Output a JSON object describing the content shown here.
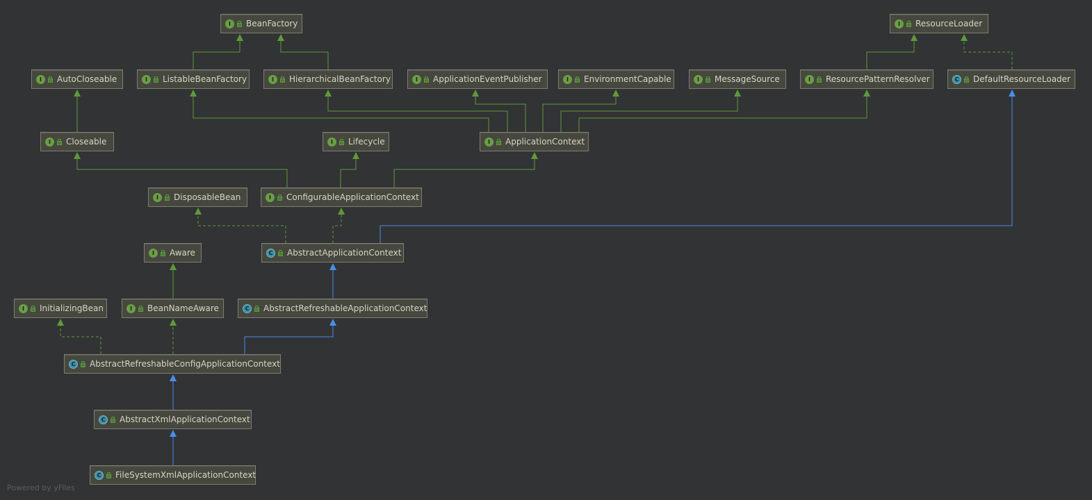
{
  "nodes": {
    "BeanFactory": {
      "label": "BeanFactory",
      "kind": "I"
    },
    "ResourceLoader": {
      "label": "ResourceLoader",
      "kind": "I"
    },
    "AutoCloseable": {
      "label": "AutoCloseable",
      "kind": "I"
    },
    "ListableBeanFactory": {
      "label": "ListableBeanFactory",
      "kind": "I"
    },
    "HierarchicalBeanFactory": {
      "label": "HierarchicalBeanFactory",
      "kind": "I"
    },
    "ApplicationEventPublisher": {
      "label": "ApplicationEventPublisher",
      "kind": "I"
    },
    "EnvironmentCapable": {
      "label": "EnvironmentCapable",
      "kind": "I"
    },
    "MessageSource": {
      "label": "MessageSource",
      "kind": "I"
    },
    "ResourcePatternResolver": {
      "label": "ResourcePatternResolver",
      "kind": "I"
    },
    "DefaultResourceLoader": {
      "label": "DefaultResourceLoader",
      "kind": "C"
    },
    "Closeable": {
      "label": "Closeable",
      "kind": "I"
    },
    "Lifecycle": {
      "label": "Lifecycle",
      "kind": "I"
    },
    "ApplicationContext": {
      "label": "ApplicationContext",
      "kind": "I"
    },
    "DisposableBean": {
      "label": "DisposableBean",
      "kind": "I"
    },
    "ConfigurableApplicationContext": {
      "label": "ConfigurableApplicationContext",
      "kind": "I"
    },
    "Aware": {
      "label": "Aware",
      "kind": "I"
    },
    "AbstractApplicationContext": {
      "label": "AbstractApplicationContext",
      "kind": "C"
    },
    "InitializingBean": {
      "label": "InitializingBean",
      "kind": "I"
    },
    "BeanNameAware": {
      "label": "BeanNameAware",
      "kind": "I"
    },
    "AbstractRefreshableApplicationContext": {
      "label": "AbstractRefreshableApplicationContext",
      "kind": "C"
    },
    "AbstractRefreshableConfigApplicationContext": {
      "label": "AbstractRefreshableConfigApplicationContext",
      "kind": "C"
    },
    "AbstractXmlApplicationContext": {
      "label": "AbstractXmlApplicationContext",
      "kind": "C"
    },
    "FileSystemXmlApplicationContext": {
      "label": "FileSystemXmlApplicationContext",
      "kind": "C"
    }
  },
  "relations": [
    {
      "from": "ListableBeanFactory",
      "to": "BeanFactory",
      "type": "extends"
    },
    {
      "from": "HierarchicalBeanFactory",
      "to": "BeanFactory",
      "type": "extends"
    },
    {
      "from": "ResourcePatternResolver",
      "to": "ResourceLoader",
      "type": "extends"
    },
    {
      "from": "DefaultResourceLoader",
      "to": "ResourceLoader",
      "type": "implements"
    },
    {
      "from": "Closeable",
      "to": "AutoCloseable",
      "type": "extends"
    },
    {
      "from": "ApplicationContext",
      "to": "ListableBeanFactory",
      "type": "extends"
    },
    {
      "from": "ApplicationContext",
      "to": "HierarchicalBeanFactory",
      "type": "extends"
    },
    {
      "from": "ApplicationContext",
      "to": "ApplicationEventPublisher",
      "type": "extends"
    },
    {
      "from": "ApplicationContext",
      "to": "EnvironmentCapable",
      "type": "extends"
    },
    {
      "from": "ApplicationContext",
      "to": "MessageSource",
      "type": "extends"
    },
    {
      "from": "ApplicationContext",
      "to": "ResourcePatternResolver",
      "type": "extends"
    },
    {
      "from": "ConfigurableApplicationContext",
      "to": "Closeable",
      "type": "extends"
    },
    {
      "from": "ConfigurableApplicationContext",
      "to": "Lifecycle",
      "type": "extends"
    },
    {
      "from": "ConfigurableApplicationContext",
      "to": "ApplicationContext",
      "type": "extends"
    },
    {
      "from": "AbstractApplicationContext",
      "to": "DisposableBean",
      "type": "implements"
    },
    {
      "from": "AbstractApplicationContext",
      "to": "ConfigurableApplicationContext",
      "type": "implements"
    },
    {
      "from": "AbstractApplicationContext",
      "to": "DefaultResourceLoader",
      "type": "class-extends"
    },
    {
      "from": "BeanNameAware",
      "to": "Aware",
      "type": "extends"
    },
    {
      "from": "AbstractRefreshableApplicationContext",
      "to": "AbstractApplicationContext",
      "type": "class-extends"
    },
    {
      "from": "AbstractRefreshableConfigApplicationContext",
      "to": "InitializingBean",
      "type": "implements"
    },
    {
      "from": "AbstractRefreshableConfigApplicationContext",
      "to": "BeanNameAware",
      "type": "implements"
    },
    {
      "from": "AbstractRefreshableConfigApplicationContext",
      "to": "AbstractRefreshableApplicationContext",
      "type": "class-extends"
    },
    {
      "from": "AbstractXmlApplicationContext",
      "to": "AbstractRefreshableConfigApplicationContext",
      "type": "class-extends"
    },
    {
      "from": "FileSystemXmlApplicationContext",
      "to": "AbstractXmlApplicationContext",
      "type": "class-extends"
    }
  ],
  "colors": {
    "extends": "#5e9a3a",
    "implements": "#5e9a3a",
    "class-extends": "#4a8ee8"
  },
  "footer": "Powered by yFiles"
}
